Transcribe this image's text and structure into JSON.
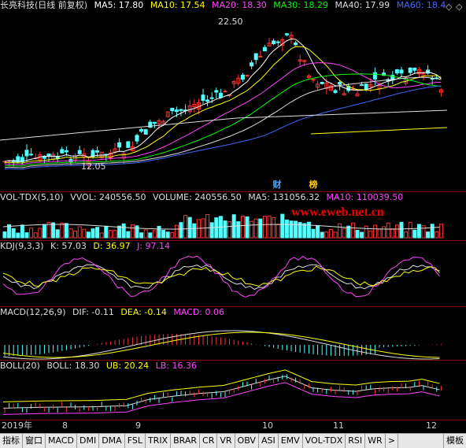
{
  "main": {
    "title": "长亮科技(日线 前复权)",
    "ma": [
      {
        "label": "MA5: 17.80",
        "color": "#ffffff"
      },
      {
        "label": "MA10: 17.54",
        "color": "#ffff00"
      },
      {
        "label": "MA20: 18.30",
        "color": "#ff44ff"
      },
      {
        "label": "MA30: 18.29",
        "color": "#00ff00"
      },
      {
        "label": "MA40: 17.99",
        "color": "#dddddd"
      },
      {
        "label": "MA60: 18.4",
        "color": "#4466ff"
      }
    ],
    "ctrl_icons": [
      "diamond-icon",
      "diamond-icon"
    ],
    "high_label": "22.50",
    "low_label": "12.05",
    "tag_cai": "财",
    "tag_bang": "榜"
  },
  "vol": {
    "name": "VOL-TDX(5,10)",
    "items": [
      {
        "label": "VVOL: 240556.50",
        "color": "#dddddd"
      },
      {
        "label": "VOLUME: 240556.50",
        "color": "#dddddd"
      },
      {
        "label": "MA5: 131056.32",
        "color": "#dddddd"
      },
      {
        "label": "MA10: 110039.50",
        "color": "#ff44ff"
      }
    ],
    "watermark": "www.eweb.net.cn"
  },
  "kdj": {
    "name": "KDJ(9,3,3)",
    "items": [
      {
        "label": "K: 57.03",
        "color": "#dddddd"
      },
      {
        "label": "D: 36.97",
        "color": "#ffff00"
      },
      {
        "label": "J: 97.14",
        "color": "#ff44ff"
      }
    ]
  },
  "macd": {
    "name": "MACD(12,26,9)",
    "items": [
      {
        "label": "DIF: -0.11",
        "color": "#dddddd"
      },
      {
        "label": "DEA: -0.14",
        "color": "#ffff00"
      },
      {
        "label": "MACD: 0.06",
        "color": "#ff44ff"
      }
    ]
  },
  "boll": {
    "name": "BOLL(20)",
    "items": [
      {
        "label": "BOLL: 18.30",
        "color": "#dddddd"
      },
      {
        "label": "UB: 20.24",
        "color": "#ffff00"
      },
      {
        "label": "LB: 16.36",
        "color": "#ff44ff"
      }
    ]
  },
  "dates": [
    "2019年",
    "8",
    "9",
    "10",
    "11",
    "12"
  ],
  "tabs": [
    "指标",
    "窗口",
    "MACD",
    "DMI",
    "DMA",
    "FSL",
    "TRIX",
    "BRAR",
    "CR",
    "VR",
    "OBV",
    "ASI",
    "EMV",
    "VOL-TDX",
    "RSI",
    "WR",
    ">"
  ],
  "right_tab": "模板",
  "colors": {
    "up": "#ff3333",
    "down": "#54ffff",
    "border": "#8b0000"
  }
}
